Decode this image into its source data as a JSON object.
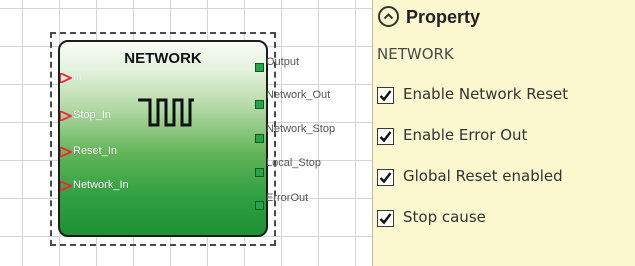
{
  "block": {
    "name": "NETWORK",
    "inputs": [
      "In",
      "Stop_In",
      "Reset_In",
      "Network_In"
    ],
    "outputs": [
      "Output",
      "Network_Out",
      "Network_Stop",
      "Local_Stop",
      "ErrorOut"
    ]
  },
  "panel": {
    "title": "Property",
    "subtitle": "NETWORK",
    "options": [
      {
        "label": "Enable Network Reset",
        "checked": true
      },
      {
        "label": "Enable Error Out",
        "checked": true
      },
      {
        "label": "Global Reset enabled",
        "checked": true
      },
      {
        "label": "Stop cause",
        "checked": true
      }
    ]
  },
  "colors": {
    "input_arrow": "#f0243a",
    "output_port": "#27a349",
    "panel_background": "#fbf8cf"
  },
  "icons": {
    "collapse": "chevron-up-circle-icon",
    "checkbox": "checkmark-icon",
    "block_symbol": "square-wave-icon"
  }
}
